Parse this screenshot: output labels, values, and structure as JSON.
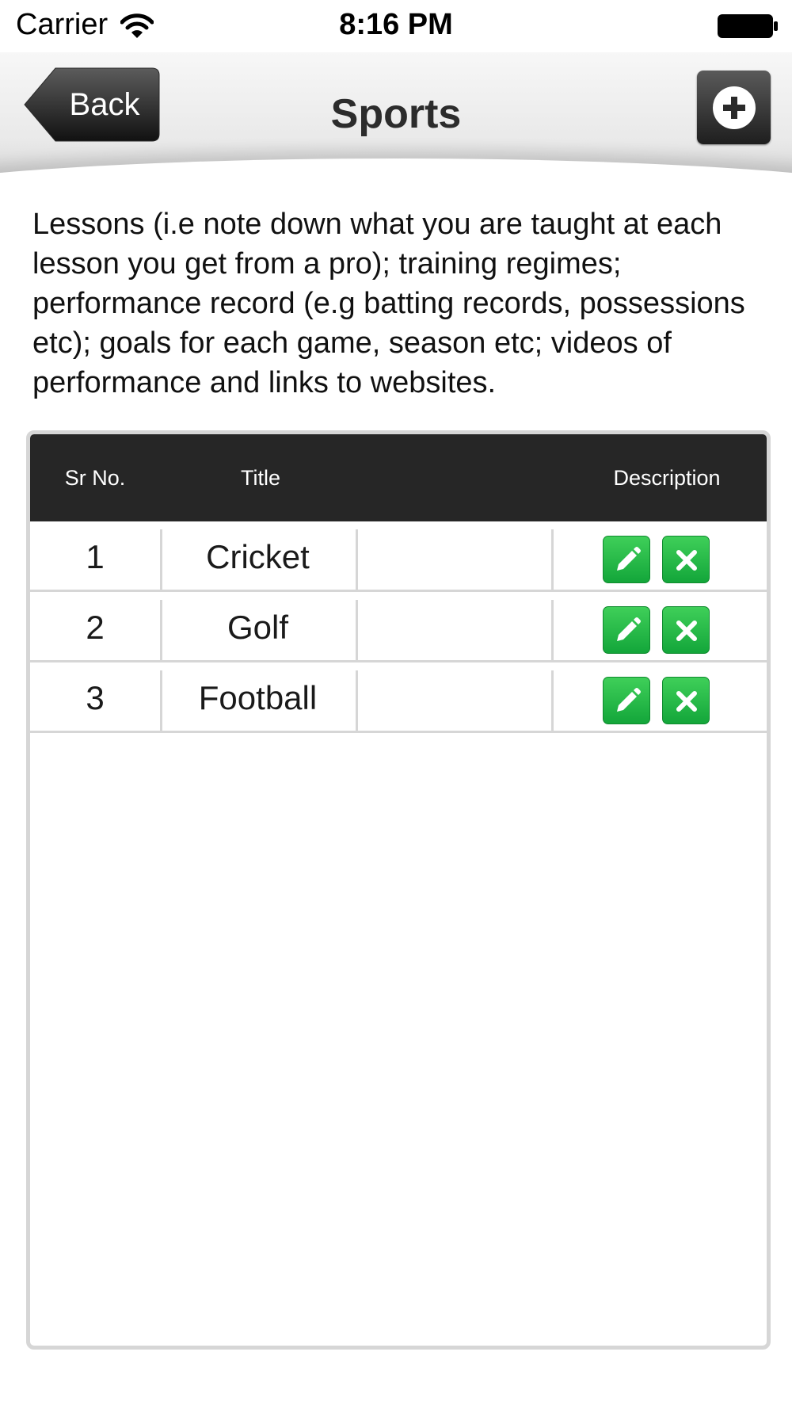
{
  "status_bar": {
    "carrier": "Carrier",
    "time": "8:16 PM",
    "icons": [
      "wifi-icon",
      "battery-icon"
    ]
  },
  "nav_bar": {
    "back_label": "Back",
    "title": "Sports",
    "add_icon": "plus-circle-icon"
  },
  "description": "Lessons (i.e note down what you are taught at each lesson you get from a pro); training regimes; performance record (e.g batting records, possessions etc); goals for each game, season etc; videos of performance and links to websites.",
  "table": {
    "headers": {
      "sr_no": "Sr No.",
      "title": "Title",
      "description": "Description"
    },
    "rows": [
      {
        "sr_no": "1",
        "title": "Cricket",
        "description": ""
      },
      {
        "sr_no": "2",
        "title": "Golf",
        "description": ""
      },
      {
        "sr_no": "3",
        "title": "Football",
        "description": ""
      }
    ],
    "row_actions": [
      "pencil-icon",
      "close-icon"
    ]
  },
  "colors": {
    "header_bg": "#262626",
    "action_green": "#22b845",
    "border_gray": "#d6d6d6"
  }
}
